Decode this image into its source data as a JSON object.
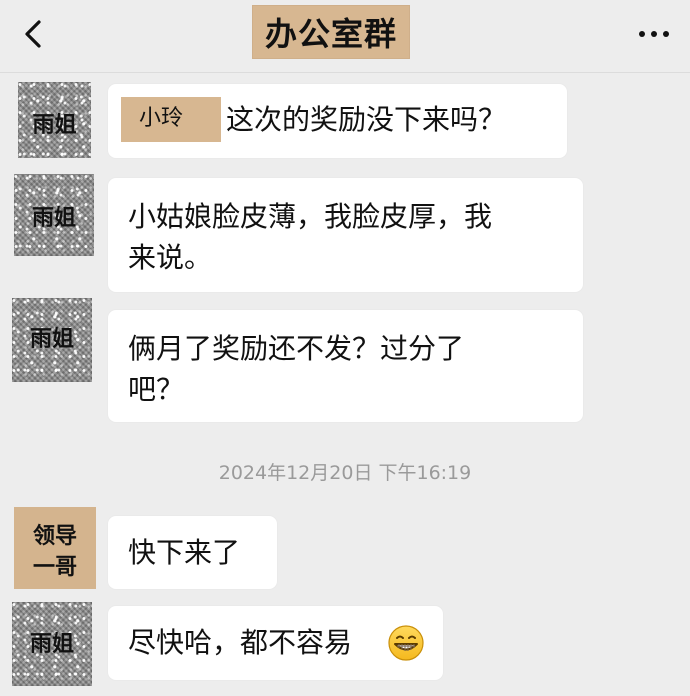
{
  "header": {
    "back_icon": "chevron-left-icon",
    "title": "办公室群",
    "more_icon": "more-horizontal-icon"
  },
  "messages": [
    {
      "avatar_label": "雨姐",
      "mention": "小玲",
      "text": "这次的奖励没下来吗？"
    },
    {
      "avatar_label": "雨姐",
      "lines": [
        "小姑娘脸皮薄，我脸皮厚，我",
        "来说。"
      ]
    },
    {
      "avatar_label": "雨姐",
      "lines": [
        "俩月了奖励还不发？过分了",
        "吧？"
      ]
    }
  ],
  "timestamp": "2024年12月20日 下午16:19",
  "later_messages": [
    {
      "avatar_lines": [
        "领导",
        "一哥"
      ],
      "text": "快下来了"
    },
    {
      "avatar_label": "雨姐",
      "text": "尽快哈，都不容易",
      "emoji_icon": "grinning-face-icon"
    }
  ],
  "colors": {
    "background": "#ededed",
    "bubble": "#ffffff",
    "title_label_bg": "#d7b791",
    "leader_avatar_bg": "#d4b48e",
    "timestamp_text": "#9a9a9a"
  }
}
